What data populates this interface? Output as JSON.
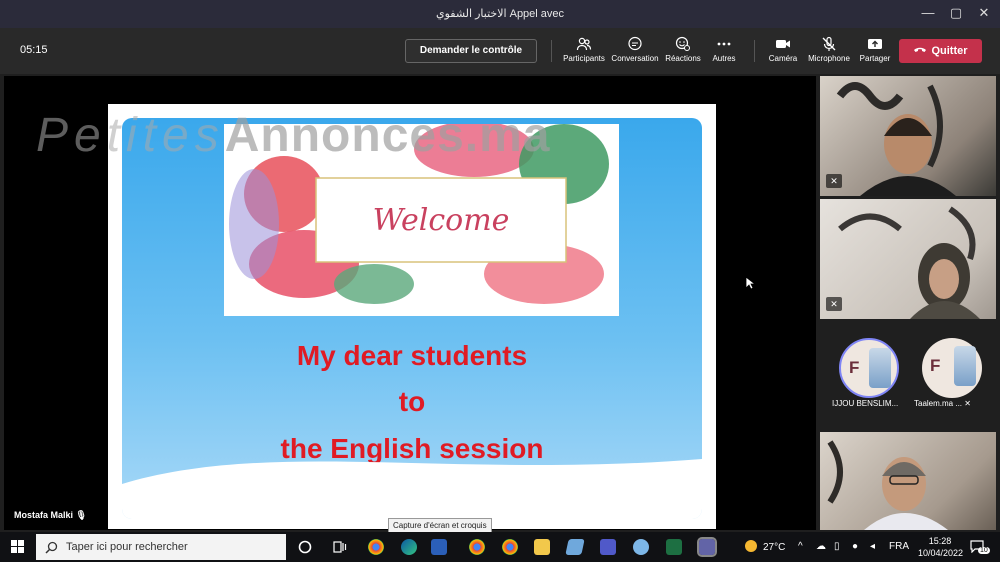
{
  "window": {
    "title": "الاختبار الشفوي Appel avec"
  },
  "toolbar": {
    "timer": "05:15",
    "request_control": "Demander le contrôle",
    "participants": "Participants",
    "conversation": "Conversation",
    "reactions": "Réactions",
    "more": "Autres",
    "camera": "Caméra",
    "microphone": "Microphone",
    "share": "Partager",
    "quit": "Quitter"
  },
  "slide": {
    "welcome": "Welcome",
    "line1": "My dear students",
    "line2": "to",
    "line3": "the English session"
  },
  "watermark": {
    "part1": "Petites",
    "part2": "Annonces.ma"
  },
  "presenter": {
    "name": "Mostafa Malki"
  },
  "participants": [
    {
      "initial": "F",
      "name": "IJJOU BENSLIM..."
    },
    {
      "initial": "F",
      "name": "Taalem.ma ..."
    }
  ],
  "tooltip": "Capture d'écran et croquis",
  "taskbar": {
    "search_placeholder": "Taper ici pour rechercher",
    "weather": "27°C",
    "language": "FRA",
    "time": "15:28",
    "date": "10/04/2022",
    "notifications": "10"
  },
  "colors": {
    "quit": "#c4314b",
    "slide_text": "#e01b24",
    "toolbar": "#292929"
  }
}
